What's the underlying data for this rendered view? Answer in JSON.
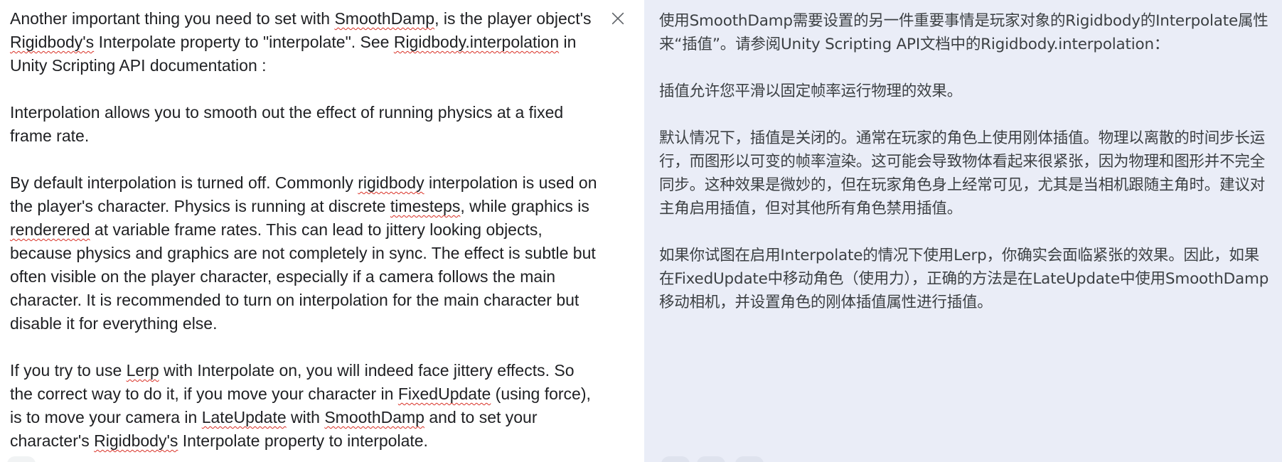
{
  "source": {
    "paragraphs": [
      [
        {
          "t": "Another important thing you need to set with "
        },
        {
          "t": "SmoothDamp",
          "spell": true
        },
        {
          "t": ", is the player object's "
        },
        {
          "t": "Rigidbody's",
          "spell": true
        },
        {
          "t": " Interpolate property to \"interpolate\". See "
        },
        {
          "t": "Rigidbody.interpolation",
          "spell": true
        },
        {
          "t": " in Unity Scripting API documentation :"
        }
      ],
      [
        {
          "t": "Interpolation allows you to smooth out the effect of running physics at a fixed frame rate."
        }
      ],
      [
        {
          "t": "By default interpolation is turned off. Commonly "
        },
        {
          "t": "rigidbody",
          "spell": true
        },
        {
          "t": " interpolation is used on the player's character. Physics is running at discrete "
        },
        {
          "t": "timesteps",
          "spell": true
        },
        {
          "t": ", while graphics is "
        },
        {
          "t": "renderered",
          "spell": true
        },
        {
          "t": " at variable frame rates. This can lead to jittery looking objects, because physics and graphics are not completely in sync. The effect is subtle but often visible on the player character, especially if a camera follows the main character. It is recommended to turn on interpolation for the main character but disable it for everything else."
        }
      ],
      [
        {
          "t": "If you try to use "
        },
        {
          "t": "Lerp",
          "spell": true
        },
        {
          "t": " with Interpolate on, you will indeed face jittery effects. So the correct way to do it, if you move your character in "
        },
        {
          "t": "FixedUpdate",
          "spell": true
        },
        {
          "t": " (using force), is to move your camera in "
        },
        {
          "t": "LateUpdate",
          "spell": true
        },
        {
          "t": " with "
        },
        {
          "t": "SmoothDamp",
          "spell": true
        },
        {
          "t": " and to set your character's "
        },
        {
          "t": "Rigidbody's",
          "spell": true
        },
        {
          "t": " Interpolate property to interpolate."
        }
      ]
    ],
    "clear_icon": "close-icon"
  },
  "target": {
    "paragraphs": [
      "使用SmoothDamp需要设置的另一件重要事情是玩家对象的Rigidbody的Interpolate属性来“插值”。请参阅Unity Scripting API文档中的Rigidbody.interpolation：",
      "插值允许您平滑以固定帧率运行物理的效果。",
      "默认情况下，插值是关闭的。通常在玩家的角色上使用刚体插值。物理以离散的时间步长运行，而图形以可变的帧率渲染。这可能会导致物体看起来很紧张，因为物理和图形并不完全同步。这种效果是微妙的，但在玩家角色身上经常可见，尤其是当相机跟随主角时。建议对主角启用插值，但对其他所有角色禁用插值。",
      "如果你试图在启用Interpolate的情况下使用Lerp，你确实会面临紧张的效果。因此，如果在FixedUpdate中移动角色（使用力），正确的方法是在LateUpdate中使用SmoothDamp移动相机，并设置角色的刚体插值属性进行插值。"
    ]
  },
  "colors": {
    "target_bg": "#eaedf7",
    "spellcheck": "#d93025",
    "text": "#202124",
    "icon": "#5f6368"
  }
}
